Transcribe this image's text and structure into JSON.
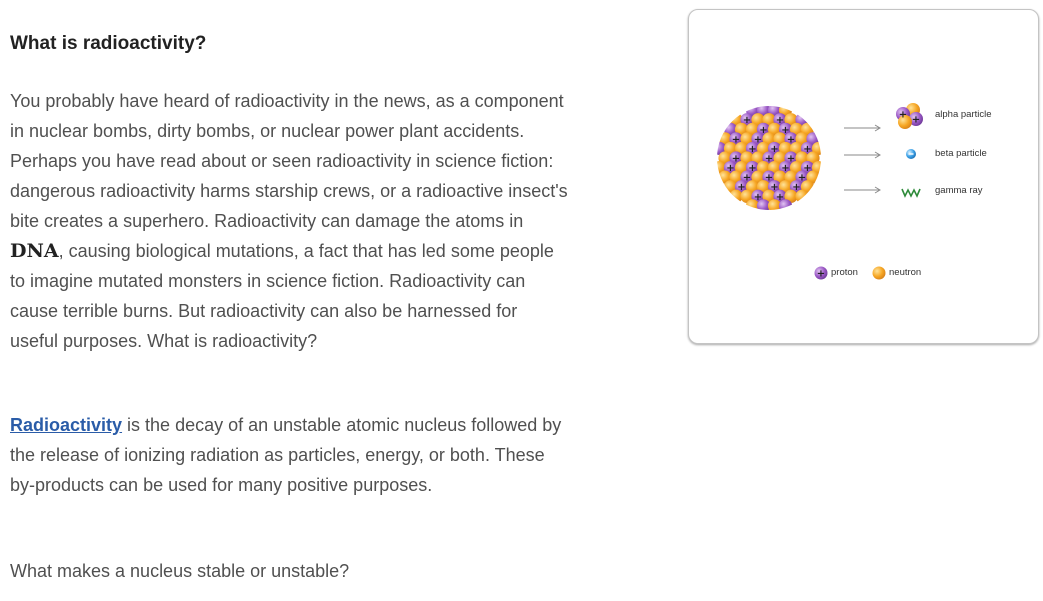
{
  "heading": "What is radioactivity?",
  "intro": {
    "before_dna": "You probably have heard of radioactivity in the news, as a component in nuclear bombs, dirty bombs, or nuclear power plant accidents. Perhaps you have read about or seen radioactivity in science fiction: dangerous radioactivity harms starship crews, or a radioactive insect's bite creates a superhero. Radioactivity can damage the atoms in ",
    "dna": "DNA",
    "after_dna": ", causing biological mutations, a fact that has led some people to imagine mutated monsters in science fiction. Radioactivity can cause terrible burns. But radioactivity can also be harnessed for useful purposes. What is radioactivity?"
  },
  "definition": {
    "term": "Radioactivity",
    "text": " is the decay of an unstable atomic nucleus followed by the release of ionizing radiation as particles, energy, or both. These by-products can be used for many positive purposes."
  },
  "question": "What makes a nucleus stable or unstable?",
  "figure": {
    "emissions": [
      "alpha particle",
      "beta particle",
      "gamma ray"
    ],
    "legend": [
      "proton",
      "neutron"
    ],
    "proton_color": "#9b59c6",
    "neutron_color": "#f6a623"
  }
}
